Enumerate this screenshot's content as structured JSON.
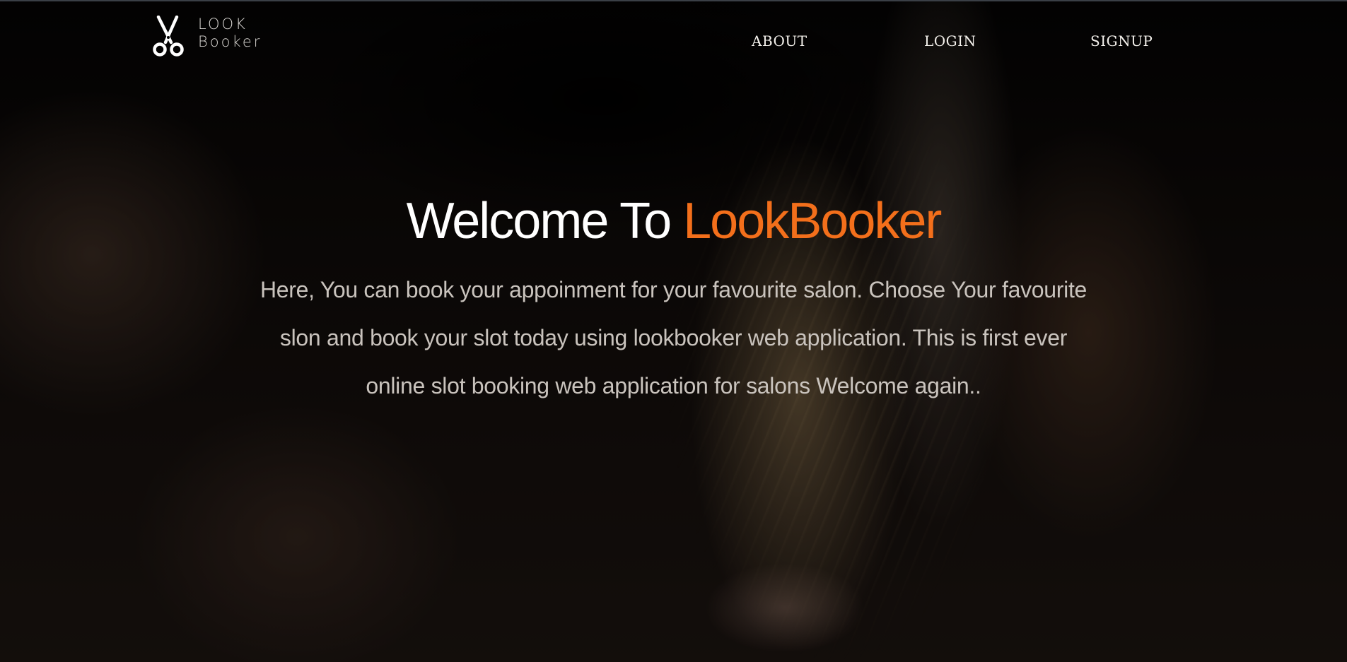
{
  "header": {
    "logo": {
      "icon": "scissors-icon",
      "line1": "LOOK",
      "line2": "Booker"
    },
    "nav": {
      "about": "ABOUT",
      "login": "LOGIN",
      "signup": "SIGNUP"
    }
  },
  "hero": {
    "title_prefix": "Welcome To ",
    "title_brand": "LookBooker",
    "description": "Here, You can book your appoinment for your favourite salon. Choose Your favourite slon and book your slot today using lookbooker web application. This is first ever online slot booking web application for salons Welcome again.."
  },
  "colors": {
    "brand_accent": "#f36f1b",
    "nav_text": "#f3f0eb",
    "body_text": "#c9c3bd"
  }
}
